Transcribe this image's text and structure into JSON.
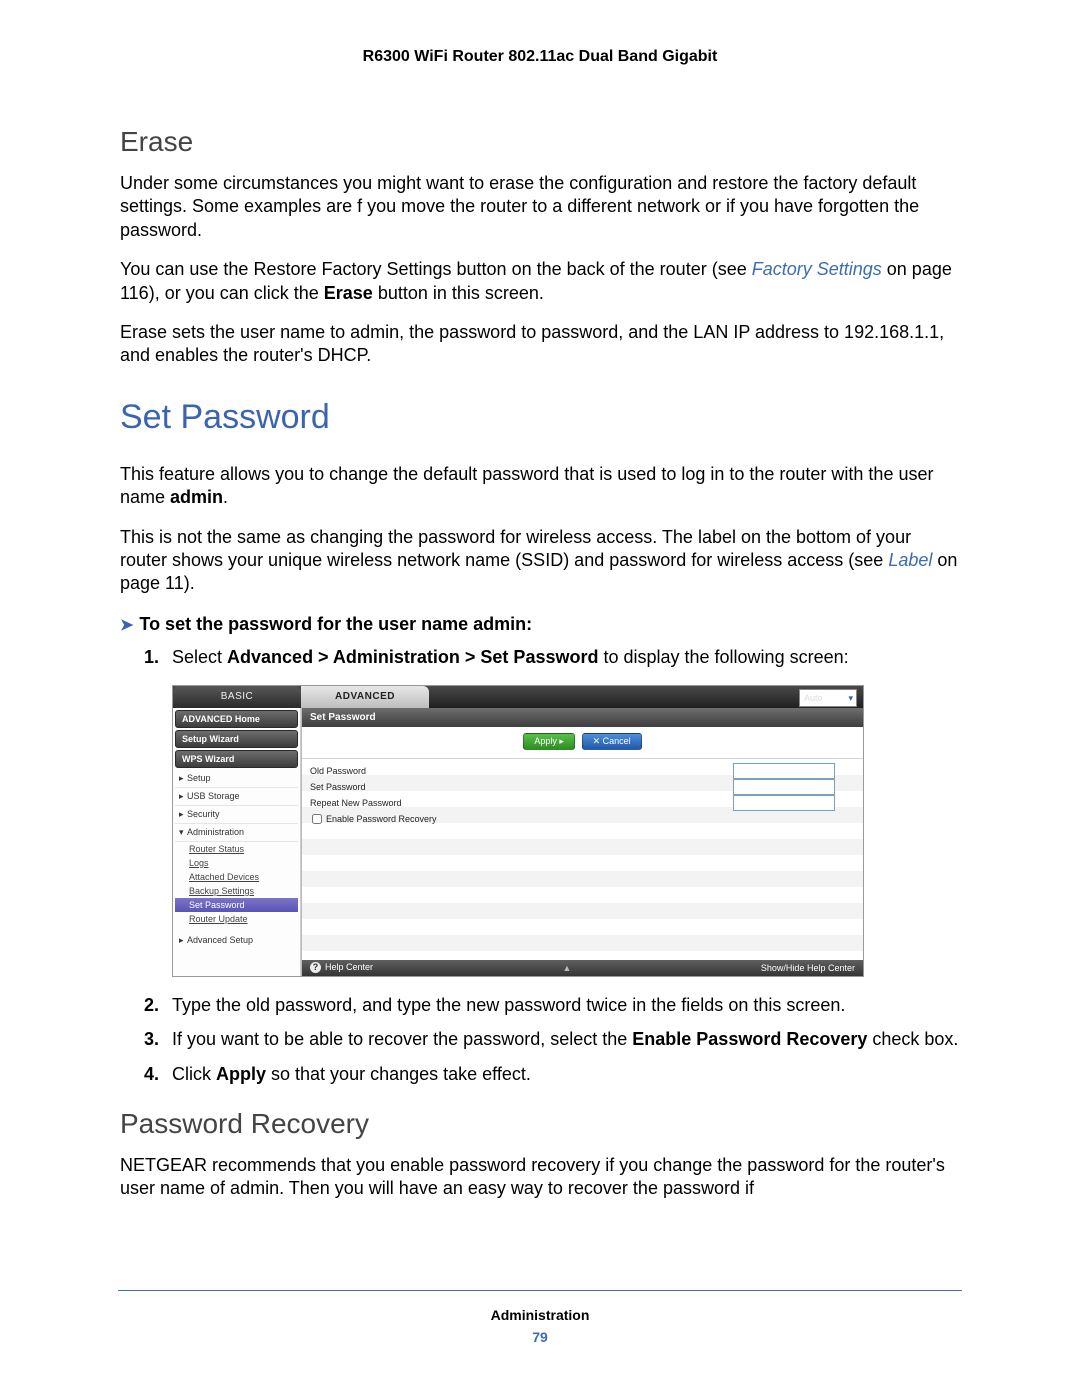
{
  "document": {
    "title": "R6300 WiFi Router 802.11ac Dual Band Gigabit",
    "footer_chapter": "Administration",
    "page_number": "79"
  },
  "erase": {
    "heading": "Erase",
    "p1": "Under some circumstances you might want to erase the configuration and restore the factory default settings. Some examples are f you move the router to a different network or if you have forgotten the password.",
    "p2_a": "You can use the Restore Factory Settings button on the back of the router (see ",
    "p2_link": "Factory Settings",
    "p2_b": " on page 116), or you can click the ",
    "p2_erase": "Erase",
    "p2_c": " button in this screen.",
    "p3": "Erase sets the user name to admin, the password to password, and the LAN IP address to 192.168.1.1, and enables the router's DHCP."
  },
  "setpw": {
    "heading": "Set Password",
    "p1_a": "This feature allows you to change the default password that is used to log in to the router with the user name ",
    "p1_admin": "admin",
    "p1_b": ".",
    "p2_a": "This is not the same as changing the password for wireless access. The label on the bottom of your router shows your unique wireless network name (SSID) and password for wireless access (see ",
    "p2_link": "Label",
    "p2_b": " on page 11).",
    "proc_heading": "To set the password for the user name admin:",
    "step1_a": "Select ",
    "step1_nav": "Advanced > Administration > Set Password",
    "step1_b": " to display the following screen:",
    "step2": "Type the old password, and type the new password twice in the fields on this screen.",
    "step3_a": "If you want to be able to recover the password, select the ",
    "step3_b": "Enable Password Recovery",
    "step3_c": " check box.",
    "step4_a": "Click ",
    "step4_b": "Apply",
    "step4_c": " so that your changes take effect."
  },
  "recovery": {
    "heading": "Password Recovery",
    "p1": "NETGEAR recommends that you enable password recovery if you change the password for the router's user name of admin. Then you will have an easy way to recover the password if"
  },
  "ui": {
    "tabs": {
      "basic": "BASIC",
      "advanced": "ADVANCED"
    },
    "auto": "Auto",
    "sidebar": {
      "adv_home": "ADVANCED Home",
      "setup_wiz": "Setup Wizard",
      "wps_wiz": "WPS Wizard",
      "setup": "Setup",
      "usb": "USB Storage",
      "security": "Security",
      "admin": "Administration",
      "subs": {
        "status": "Router Status",
        "logs": "Logs",
        "attached": "Attached Devices",
        "backup": "Backup Settings",
        "setpw": "Set Password",
        "update": "Router Update"
      },
      "adv_setup": "Advanced Setup"
    },
    "content": {
      "title": "Set Password",
      "apply": "Apply ▸",
      "cancel": "✕ Cancel",
      "old": "Old Password",
      "new": "Set Password",
      "repeat": "Repeat New Password",
      "enable": "Enable Password Recovery"
    },
    "help": {
      "left": "Help Center",
      "right": "Show/Hide Help Center"
    }
  }
}
